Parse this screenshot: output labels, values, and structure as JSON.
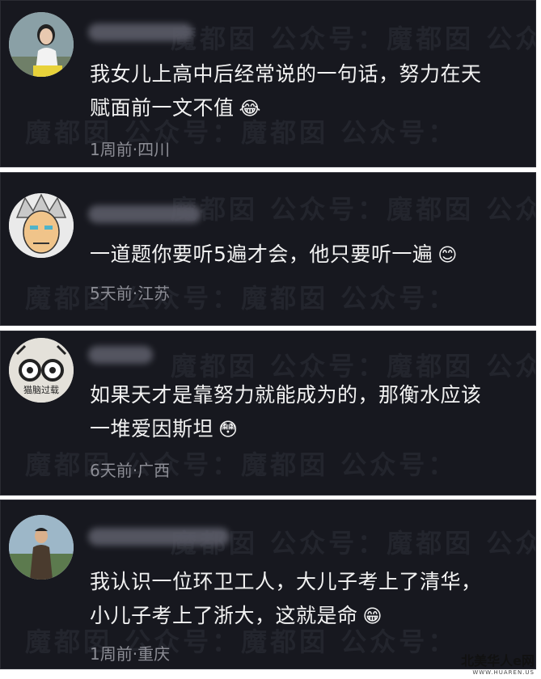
{
  "watermark": "魔都囡 公众号：魔都囡 公众号：",
  "comments": [
    {
      "text_line1": "我女儿上高中后经常说的一句话，努力在天",
      "text_line2": "赋面前一文不值",
      "emoji": "😂",
      "meta": "1周前·四川"
    },
    {
      "text_line1": "一道题你要听5遍才会，他只要听一遍",
      "emoji": "😊",
      "meta": "5天前·江苏"
    },
    {
      "avatar_caption": "猫脑过载",
      "text_line1": "如果天才是靠努力就能成为的，那衡水应该",
      "text_line2": "一堆爱因斯坦",
      "emoji": "😳",
      "meta": "6天前·广西"
    },
    {
      "text_line1": "我认识一位环卫工人，大儿子考上了清华，",
      "text_line2": "小儿子考上了浙大，这就是命",
      "emoji": "😁",
      "meta": "1周前·重庆"
    }
  ],
  "site_logo": {
    "main": "北美华人e网",
    "sub": "WWW.HUAREN.US"
  }
}
